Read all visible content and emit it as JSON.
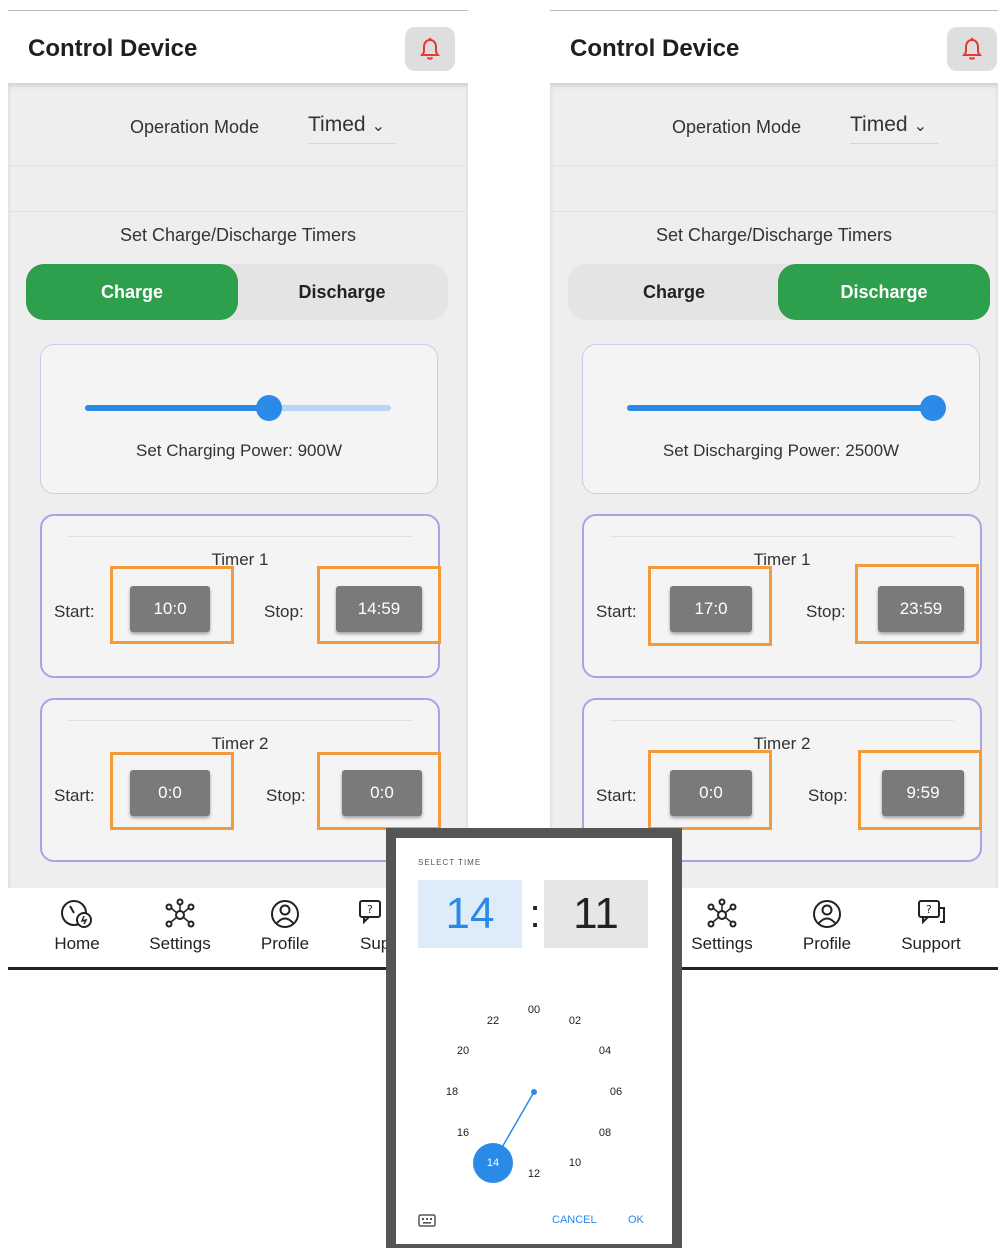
{
  "screens": [
    {
      "header_title": "Control Device",
      "operation_mode_label": "Operation Mode",
      "operation_mode_value": "Timed",
      "timers_title": "Set Charge/Discharge Timers",
      "tabs": [
        {
          "label": "Charge",
          "active": true
        },
        {
          "label": "Discharge",
          "active": false
        }
      ],
      "power_label": "Set Charging Power: 900W",
      "slider_fraction": 0.6,
      "timers": [
        {
          "title": "Timer 1",
          "start_label": "Start:",
          "start": "10:0",
          "stop_label": "Stop:",
          "stop": "14:59"
        },
        {
          "title": "Timer 2",
          "start_label": "Start:",
          "start": "0:0",
          "stop_label": "Stop:",
          "stop": "0:0"
        }
      ],
      "nav": [
        {
          "label": "Home",
          "icon": "home-gauge-icon"
        },
        {
          "label": "Settings",
          "icon": "settings-network-icon"
        },
        {
          "label": "Profile",
          "icon": "profile-icon"
        },
        {
          "label": "Sup",
          "icon": "support-icon"
        }
      ]
    },
    {
      "header_title": "Control Device",
      "operation_mode_label": "Operation Mode",
      "operation_mode_value": "Timed",
      "timers_title": "Set Charge/Discharge Timers",
      "tabs": [
        {
          "label": "Charge",
          "active": false
        },
        {
          "label": "Discharge",
          "active": true
        }
      ],
      "power_label": "Set Discharging Power: 2500W",
      "slider_fraction": 1.0,
      "timers": [
        {
          "title": "Timer 1",
          "start_label": "Start:",
          "start": "17:0",
          "stop_label": "Stop:",
          "stop": "23:59"
        },
        {
          "title": "Timer 2",
          "start_label": "Start:",
          "start": "0:0",
          "stop_label": "Stop:",
          "stop": "9:59"
        }
      ],
      "nav": [
        {
          "label": "Settings",
          "icon": "settings-network-icon"
        },
        {
          "label": "Profile",
          "icon": "profile-icon"
        },
        {
          "label": "Support",
          "icon": "support-icon"
        }
      ]
    }
  ],
  "time_picker": {
    "select_time_label": "SELECT TIME",
    "hour": "14",
    "colon": ":",
    "minute": "11",
    "dial_numbers": [
      "00",
      "02",
      "04",
      "06",
      "08",
      "10",
      "12",
      "14",
      "16",
      "18",
      "20",
      "22"
    ],
    "selected_hour": "14",
    "cancel_label": "CANCEL",
    "ok_label": "OK",
    "keyboard_icon": "keyboard-icon"
  },
  "colors": {
    "active_tab": "#2e9f4d",
    "slider": "#2a8ae8",
    "highlight": "#f39a3c",
    "timer_button": "#7a7a7a",
    "timer_card_border": "#a9a3e6"
  }
}
